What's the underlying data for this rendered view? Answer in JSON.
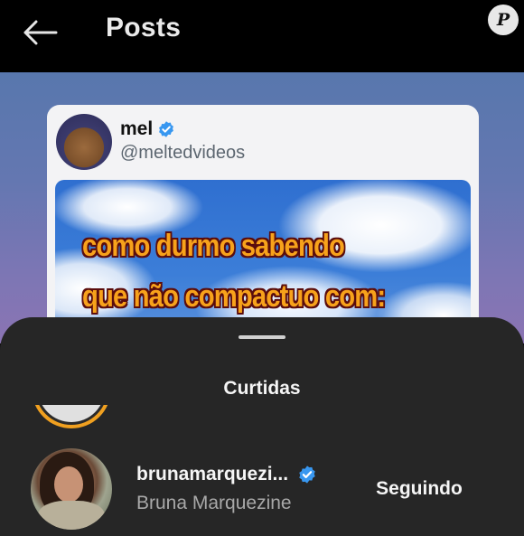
{
  "header": {
    "title": "Posts",
    "back_icon": "arrow-left-icon",
    "watermark_letter": "P"
  },
  "post": {
    "author_name": "mel",
    "author_handle": "@meltedvideos",
    "verified_icon": "verified-badge-icon",
    "meme_line_1": "como durmo sabendo",
    "meme_line_2": "que não compactuo com:"
  },
  "likes_sheet": {
    "title": "Curtidas",
    "users": [
      {
        "username": "brunamarquezi...",
        "full_name": "Bruna Marquezine",
        "verified": true,
        "follow_label": "Seguindo"
      }
    ]
  },
  "colors": {
    "app_bar": "#000000",
    "sheet_bg": "#262626",
    "verified_blue": "#3897f0",
    "meme_text": "#f7a21b",
    "meme_outline": "#5a0d0d",
    "story_ring": "#f0a020"
  }
}
